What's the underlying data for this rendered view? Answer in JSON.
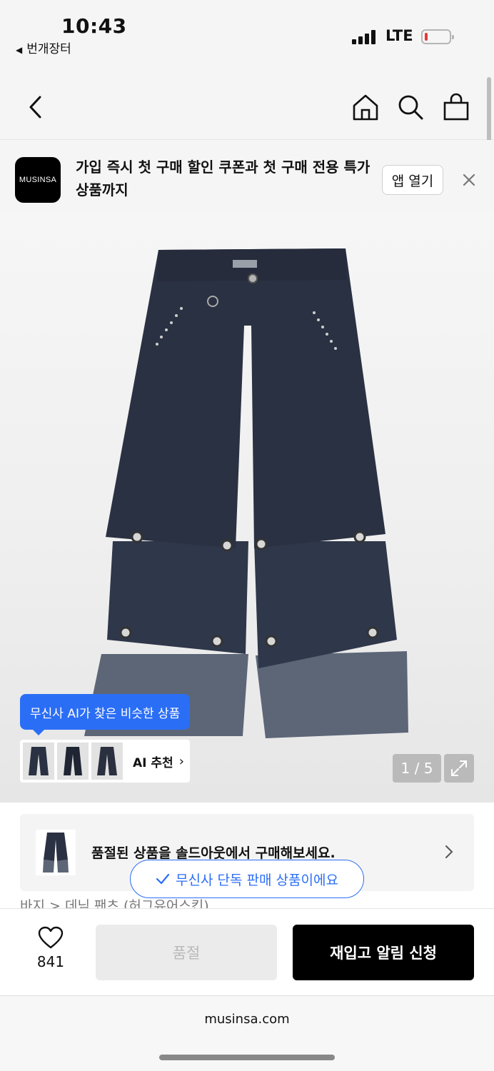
{
  "status_bar": {
    "time": "10:43",
    "back_app": "번개장터",
    "network": "LTE",
    "battery_level": 0.12,
    "battery_color": "#e53935"
  },
  "nav": {
    "back_icon": "chevron-left-icon",
    "home_icon": "home-icon",
    "search_icon": "search-icon",
    "cart_icon": "shopping-bag-icon"
  },
  "app_banner": {
    "logo_text": "MUSINSA",
    "text": "가입 즉시 첫 구매 할인 쿠폰과 첫 구매 전용 특가 상품까지",
    "open_label": "앱 열기",
    "close_icon": "close-icon"
  },
  "product_image": {
    "ai_tooltip": "무신사 AI가 찾은 비슷한 상품",
    "ai_label": "AI 추천",
    "pager": "1 / 5",
    "expand_icon": "expand-icon"
  },
  "soldout_card": {
    "text": "품절된 상품을 솔드아웃에서 구매해보세요."
  },
  "breadcrumb": "바지  >  데님 팬츠 (허그유어스킨)",
  "exclusive_badge": "무신사 단독 판매 상품이에요",
  "buy_bar": {
    "like_count": "841",
    "soldout_label": "품절",
    "restock_label": "재입고 알림 신청"
  },
  "browser": {
    "url": "musinsa.com"
  },
  "colors": {
    "accent_blue": "#2b6ef6",
    "primary_black": "#000000",
    "denim_dark": "#2a3142",
    "denim_light": "#5c6677"
  }
}
